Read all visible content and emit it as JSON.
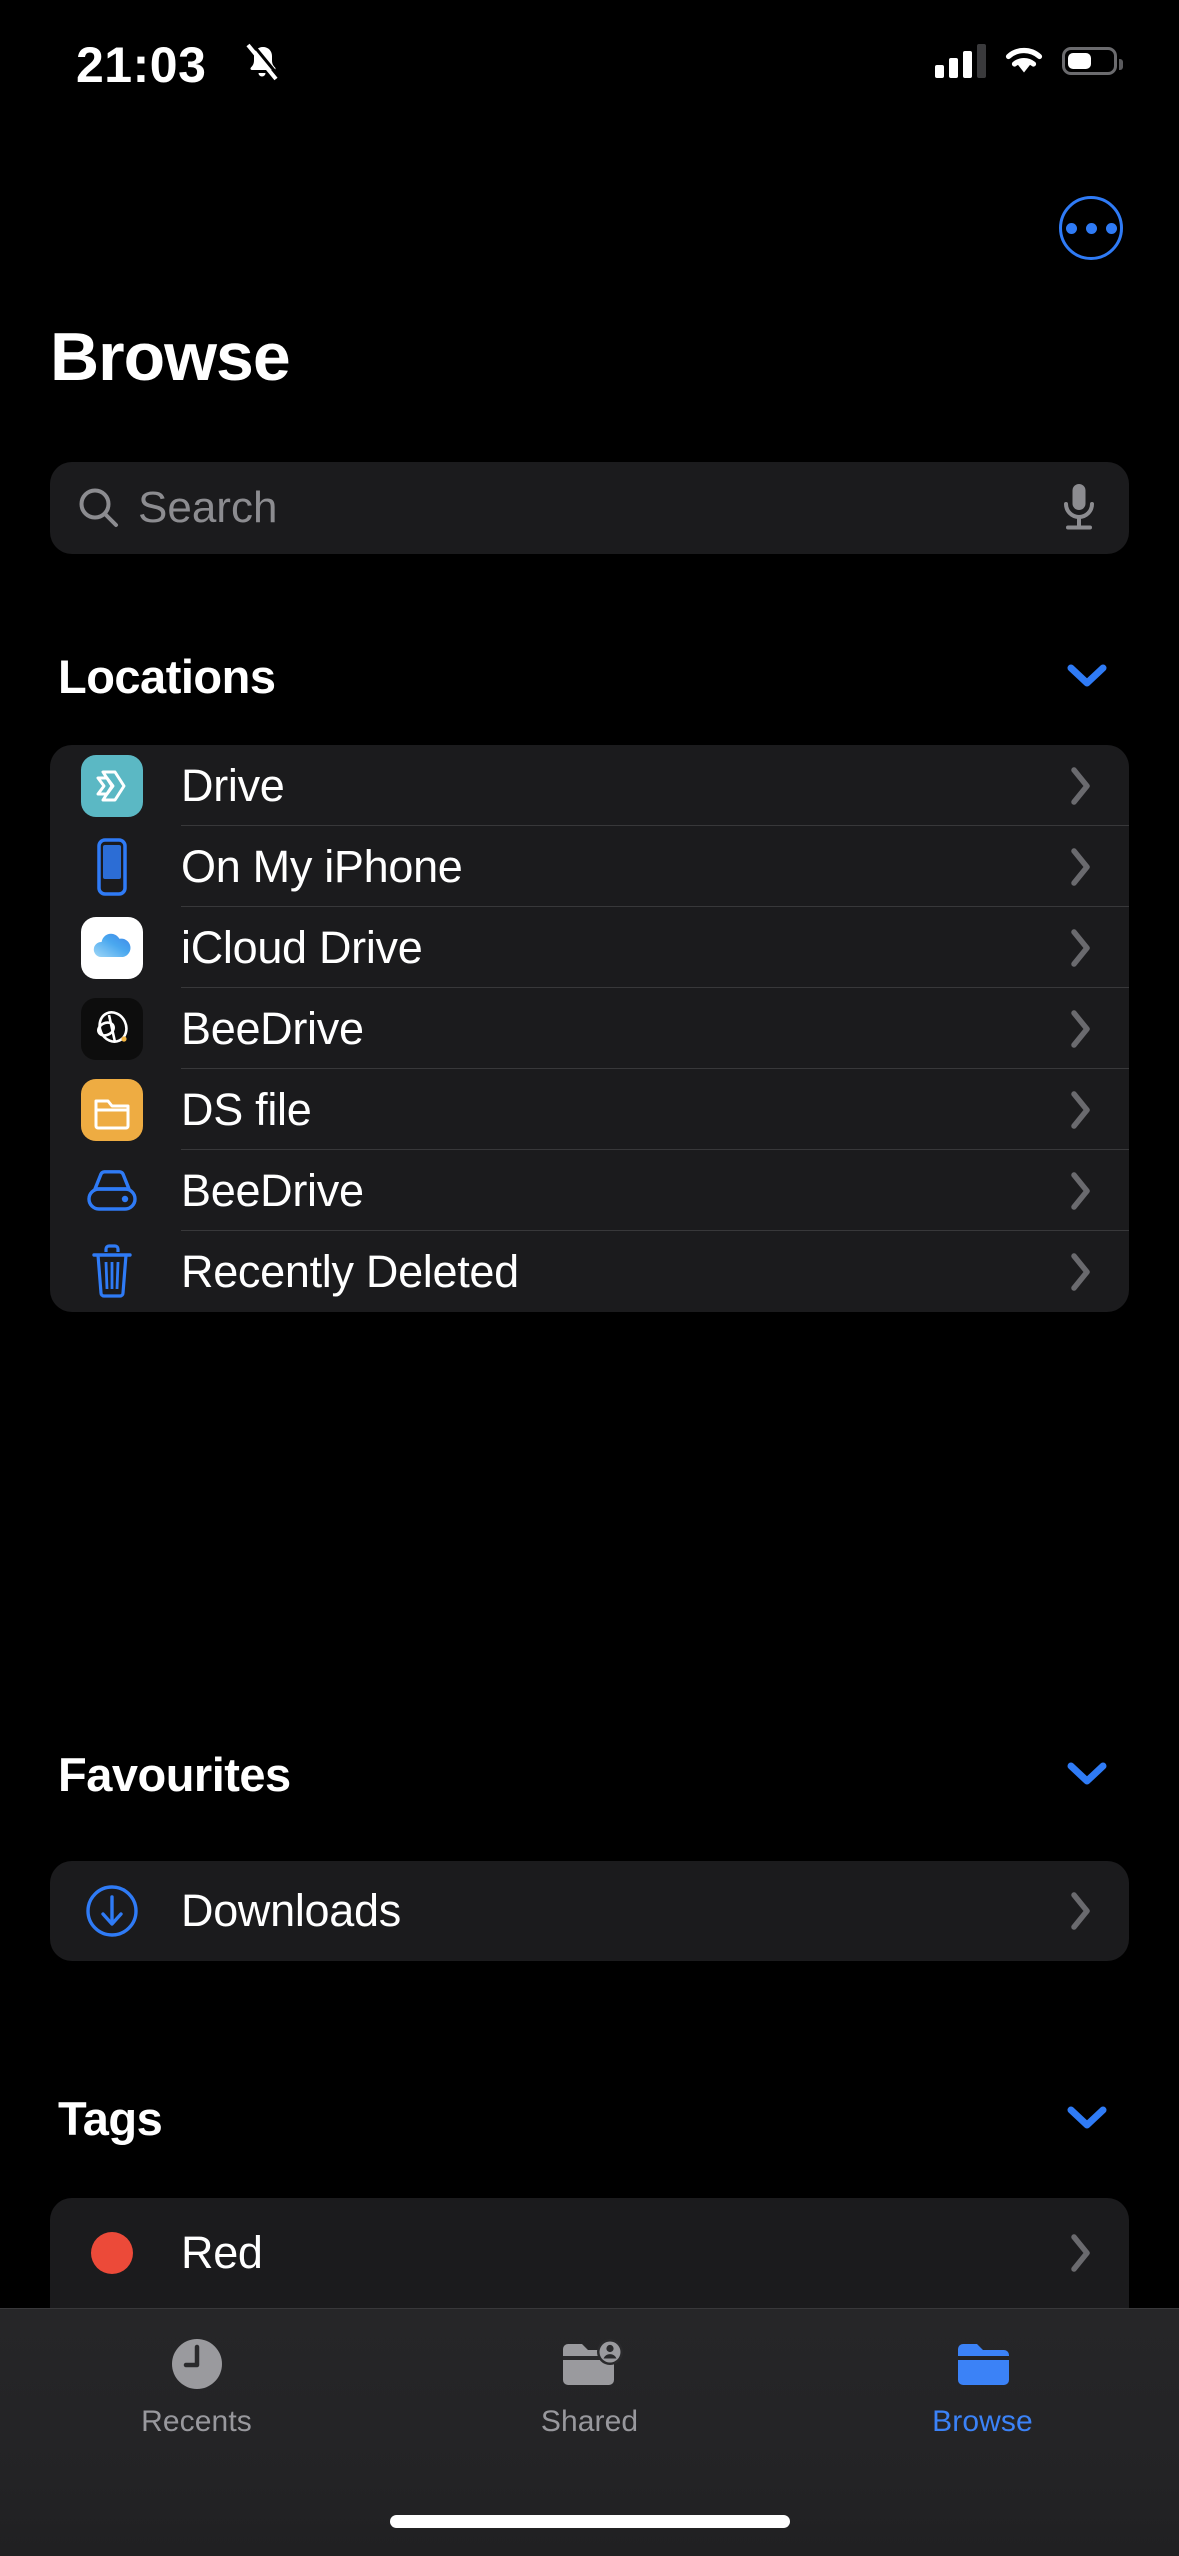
{
  "status_bar": {
    "time": "21:03",
    "silent_icon": "bell-slash-icon",
    "cellular_icon": "cellular-bars-icon",
    "wifi_icon": "wifi-icon",
    "battery_icon": "battery-icon",
    "battery_level_percent": 47
  },
  "nav": {
    "more_button": "more-options-icon"
  },
  "header": {
    "title": "Browse"
  },
  "search": {
    "placeholder": "Search",
    "value": "",
    "search_icon": "search-icon",
    "dictation_icon": "microphone-icon"
  },
  "sections": [
    {
      "title": "Locations",
      "collapse_icon": "chevron-down-icon",
      "rows": [
        {
          "label": "Drive",
          "icon": "synology-drive-app-icon",
          "icon_kind": "app",
          "bg": "#5bb8c4",
          "chevron": "chevron-right-icon"
        },
        {
          "label": "On My iPhone",
          "icon": "iphone-icon",
          "icon_kind": "glyph",
          "bg": "#2f7bf6",
          "chevron": "chevron-right-icon"
        },
        {
          "label": "iCloud Drive",
          "icon": "icloud-drive-app-icon",
          "icon_kind": "app",
          "bg": "#ffffff",
          "chevron": "chevron-right-icon"
        },
        {
          "label": "BeeDrive",
          "icon": "beedrive-app-icon",
          "icon_kind": "app",
          "bg": "#0d0d0d",
          "chevron": "chevron-right-icon"
        },
        {
          "label": "DS file",
          "icon": "ds-file-app-icon",
          "icon_kind": "app",
          "bg": "#eeac42",
          "chevron": "chevron-right-icon"
        },
        {
          "label": "BeeDrive",
          "icon": "external-drive-icon",
          "icon_kind": "glyph",
          "bg": "#2f7bf6",
          "chevron": "chevron-right-icon"
        },
        {
          "label": "Recently Deleted",
          "icon": "trash-icon",
          "icon_kind": "glyph",
          "bg": "#2f7bf6",
          "chevron": "chevron-right-icon"
        }
      ]
    },
    {
      "title": "Favourites",
      "collapse_icon": "chevron-down-icon",
      "rows": [
        {
          "label": "Downloads",
          "icon": "download-circle-icon",
          "icon_kind": "glyph",
          "bg": "#2f7bf6",
          "chevron": "chevron-right-icon"
        }
      ]
    },
    {
      "title": "Tags",
      "collapse_icon": "chevron-down-icon",
      "rows": [
        {
          "label": "Red",
          "icon": "tag-dot-red-icon",
          "icon_kind": "dot",
          "bg": "#ec4a39",
          "chevron": "chevron-right-icon"
        }
      ]
    }
  ],
  "tab_bar": {
    "tabs": [
      {
        "label": "Recents",
        "icon": "clock-icon",
        "active": false
      },
      {
        "label": "Shared",
        "icon": "folder-person-icon",
        "active": false
      },
      {
        "label": "Browse",
        "icon": "folder-icon",
        "active": true
      }
    ]
  },
  "colors": {
    "accent_blue": "#2f7bf6",
    "tab_active_blue": "#3b82f7",
    "card_bg": "#1b1b1d",
    "page_bg": "#000000",
    "secondary_text": "#8c8c90",
    "separator": "#38383a",
    "tag_red": "#ec4a39"
  }
}
